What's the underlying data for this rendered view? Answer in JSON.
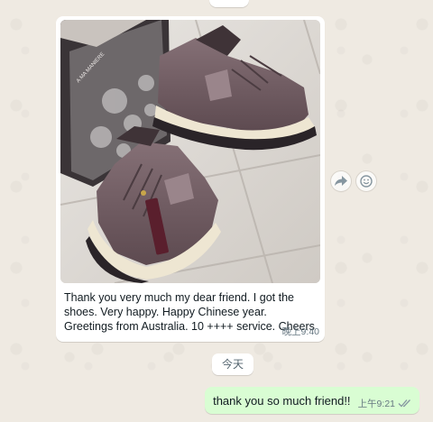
{
  "incoming": {
    "caption": "Thank you very much my dear friend. I got the shoes. Very happy. Happy Chinese year. Greetings from Australia. 10 ++++ service. Cheers",
    "time": "晚上9:40",
    "photo_box_text": "A MA MANIERE"
  },
  "date_separator": "今天",
  "outgoing": {
    "text": "thank you so much friend!!",
    "time": "上午9:21",
    "status": "read"
  },
  "colors": {
    "background": "#efeae2",
    "incoming_bubble": "#ffffff",
    "outgoing_bubble": "#d9fdd3",
    "read_tick": "#8696a0",
    "shoe": "#6e5a5f",
    "sole": "#eee6d2"
  },
  "icons": {
    "forward": "forward-arrow-icon",
    "emoji": "smiley-icon",
    "tick": "double-check-icon"
  }
}
